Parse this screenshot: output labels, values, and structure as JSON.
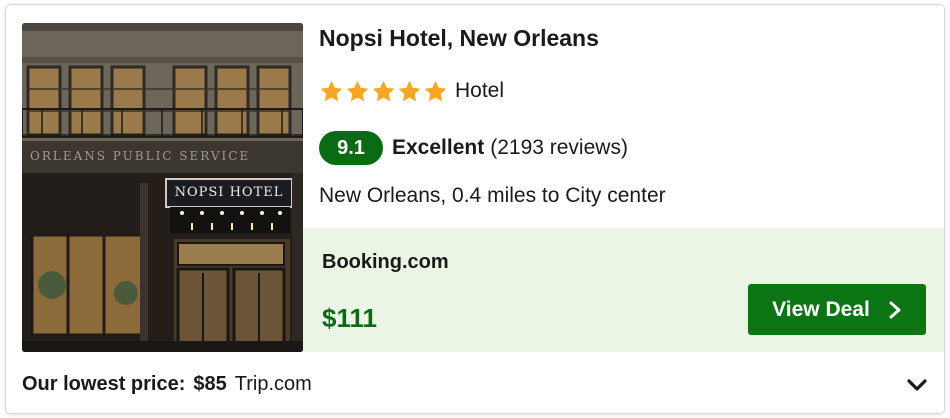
{
  "hotel": {
    "name": "Nopsi Hotel, New Orleans",
    "star_rating": 5,
    "type": "Hotel",
    "score": "9.1",
    "score_label": "Excellent",
    "review_count": "(2193 reviews)",
    "location": "New Orleans, 0.4 miles to City center",
    "photo": {
      "sign_text": "NOPSI HOTEL",
      "facade_text": "ORLEANS PUBLIC SERVICE"
    }
  },
  "deal": {
    "provider": "Booking.com",
    "price": "$111",
    "button_label": "View Deal"
  },
  "footer": {
    "lowest_label": "Our lowest price:",
    "lowest_price": "$85",
    "lowest_source": "Trip.com"
  },
  "colors": {
    "star": "#f5a623",
    "score_badge": "#0b6b14",
    "deal_background": "#ebf5e6",
    "price": "#0b6b14",
    "button": "#0b7514"
  },
  "icons": {
    "star": "star-icon",
    "button_arrow": "chevron-right-icon",
    "expand": "chevron-down-icon"
  }
}
